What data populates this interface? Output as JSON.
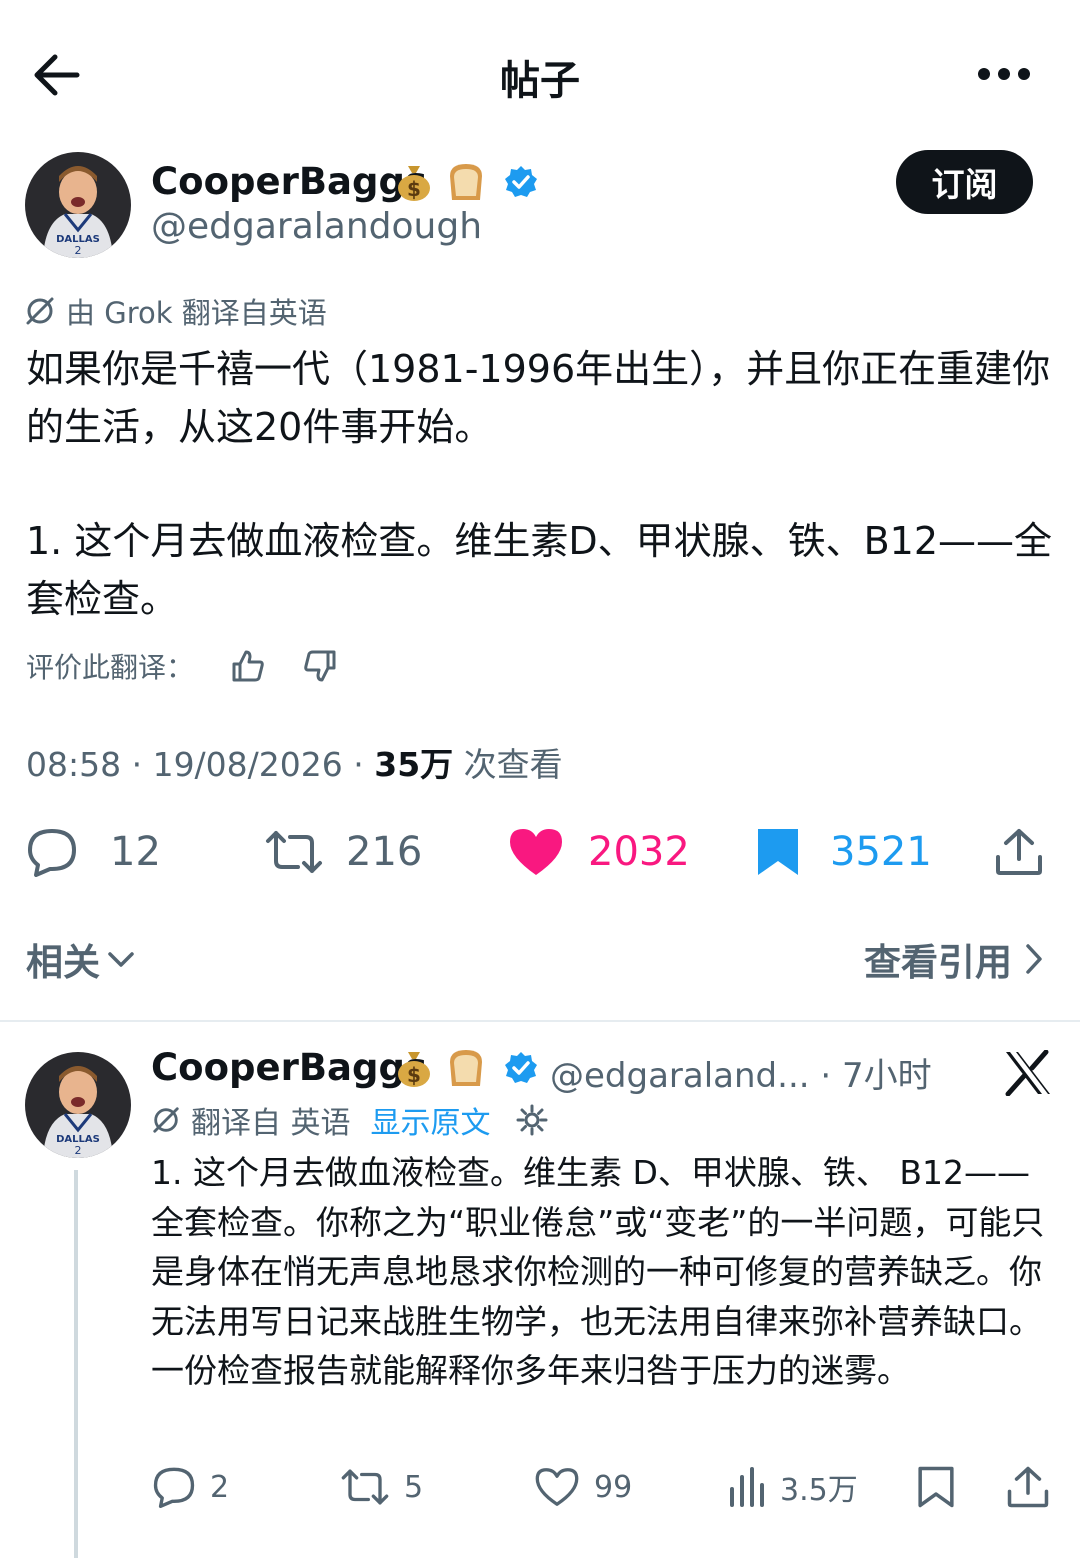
{
  "header": {
    "title": "帖子"
  },
  "post": {
    "author_name": "CooperBaggs",
    "handle": "@edgaralandough",
    "emojis": [
      "💰",
      "🍞"
    ],
    "subscribe_label": "订阅",
    "translated_note": "由 Grok 翻译自英语",
    "paragraphs": [
      "如果你是千禧一代（1981-1996年出生），并且你正在重建你的生活，从这20件事开始。",
      "1. 这个月去做血液检查。维生素D、甲状腺、铁、B12——全套检查。"
    ],
    "rate_label": "评价此翻译：",
    "meta": {
      "time_date": "08:58 · 19/08/2026 · ",
      "views": "35万",
      "views_label": " 次查看"
    },
    "actions": {
      "replies": "12",
      "reposts": "216",
      "likes": "2032",
      "bookmarks": "3521"
    }
  },
  "related": {
    "label": "相关",
    "quotes_label": "查看引用"
  },
  "reply": {
    "author_name": "CooperBaggs",
    "emojis": [
      "💰",
      "🍞"
    ],
    "handle": "@edgaraland...",
    "time": " · 7小时",
    "translated_label": "翻译自 英语",
    "show_original": "显示原文",
    "text": "1. 这个月去做血液检查。维生素 D、甲状腺、铁、 B12——全套检查。你称之为“职业倦怠”或“变老”的一半问题，可能只是身体在悄无声息地恳求你检测的一种可修复的营养缺乏。你无法用写日记来战胜生物学，也无法用自律来弥补营养缺口。一份检查报告就能解释你多年来归咎于压力的迷雾。",
    "actions": {
      "replies": "2",
      "reposts": "5",
      "likes": "99",
      "views": "3.5万"
    }
  },
  "colors": {
    "like": "#f91880",
    "bookmark": "#1d9bf0",
    "verified": "#1d9bf0",
    "muted": "#536471"
  }
}
